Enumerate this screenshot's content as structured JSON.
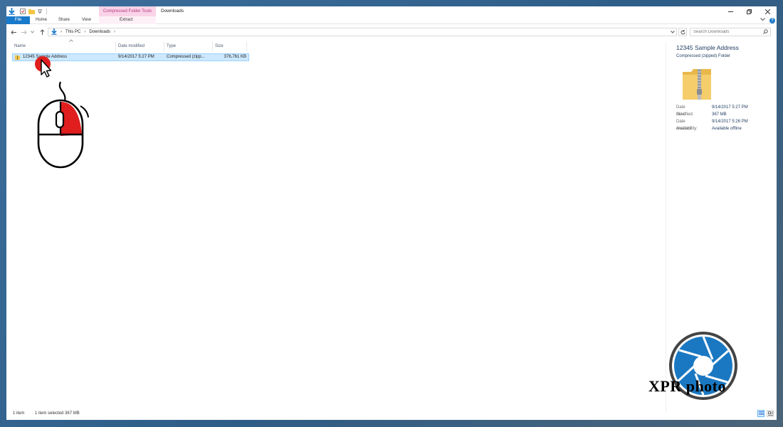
{
  "titlebar": {
    "context_group": "Compressed Folder Tools",
    "window_title": "Downloads"
  },
  "ribbon": {
    "tabs": [
      {
        "label": "File"
      },
      {
        "label": "Home"
      },
      {
        "label": "Share"
      },
      {
        "label": "View"
      },
      {
        "label": "Extract"
      }
    ],
    "help_label": "?"
  },
  "address_bar": {
    "crumbs": [
      "This PC",
      "Downloads"
    ]
  },
  "search": {
    "placeholder": "Search Downloads"
  },
  "columns": [
    "Name",
    "Date modified",
    "Type",
    "Size"
  ],
  "files": [
    {
      "name": "12345 Sample Address",
      "date_modified": "9/14/2017 5:27 PM",
      "type": "Compressed (zipp...",
      "size": "376,761 KB",
      "selected": true
    }
  ],
  "details": {
    "title": "12345 Sample Address",
    "subtitle": "Compressed (zipped) Folder",
    "props": [
      {
        "label": "Date modified:",
        "value": "9/14/2017 5:27 PM"
      },
      {
        "label": "Size:",
        "value": "367 MB"
      },
      {
        "label": "Date created:",
        "value": "9/14/2017 5:26 PM"
      },
      {
        "label": "Availability:",
        "value": "Available offline"
      }
    ]
  },
  "status": {
    "count": "1 item",
    "selection": "1 item selected  367 MB"
  },
  "watermark": {
    "text": "XPR photo"
  },
  "colors": {
    "accent": "#1979ca",
    "selection": "#cce8ff",
    "context_tab": "#f9d3e8",
    "annotation_red": "#e01e1e"
  }
}
